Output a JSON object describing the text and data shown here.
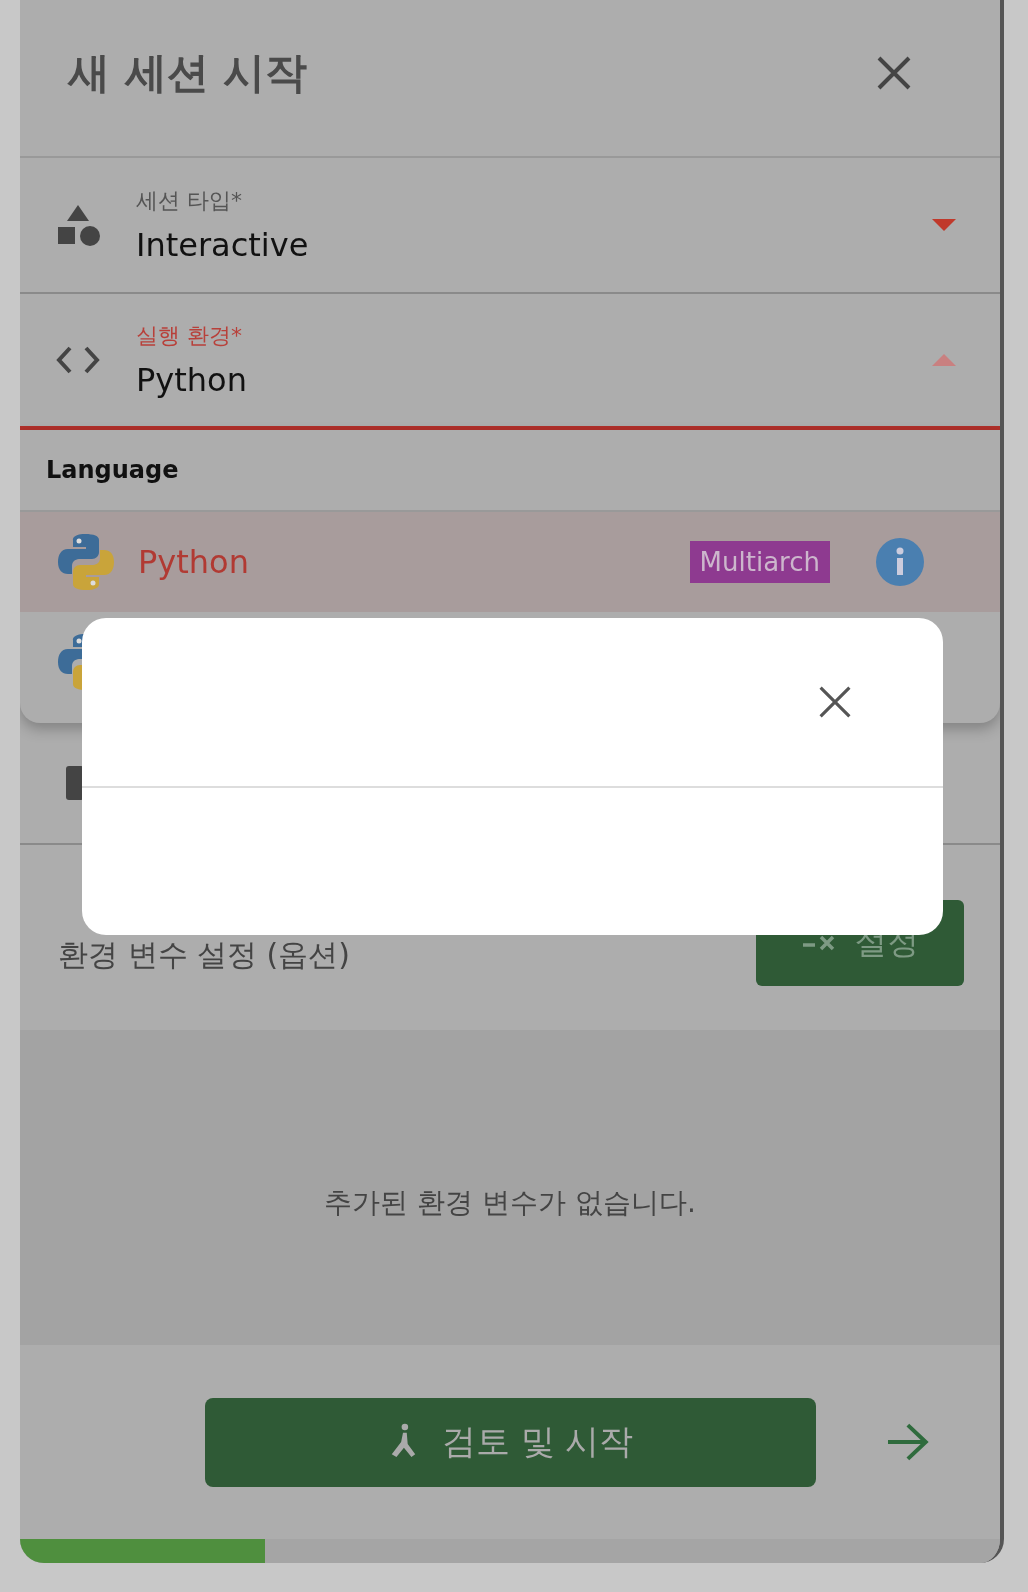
{
  "dialog": {
    "title": "새 세션 시작"
  },
  "fields": [
    {
      "label": "세션 타입*",
      "value": "Interactive",
      "kind": "shapes",
      "expanded": false
    },
    {
      "label": "실행 환경*",
      "value": "Python",
      "kind": "code",
      "expanded": true
    }
  ],
  "dropdown": {
    "group": "Language",
    "options": [
      {
        "label": "Python",
        "badge": "Multiarch",
        "selected": true
      },
      {
        "selected": false
      }
    ]
  },
  "env": {
    "label": "환경 변수 설정 (옵션)",
    "button": "설정",
    "empty_text": "추가된 환경 변수가 없습니다."
  },
  "footer": {
    "button": "검토 및 시작"
  },
  "progress": {
    "level": 0.25
  }
}
